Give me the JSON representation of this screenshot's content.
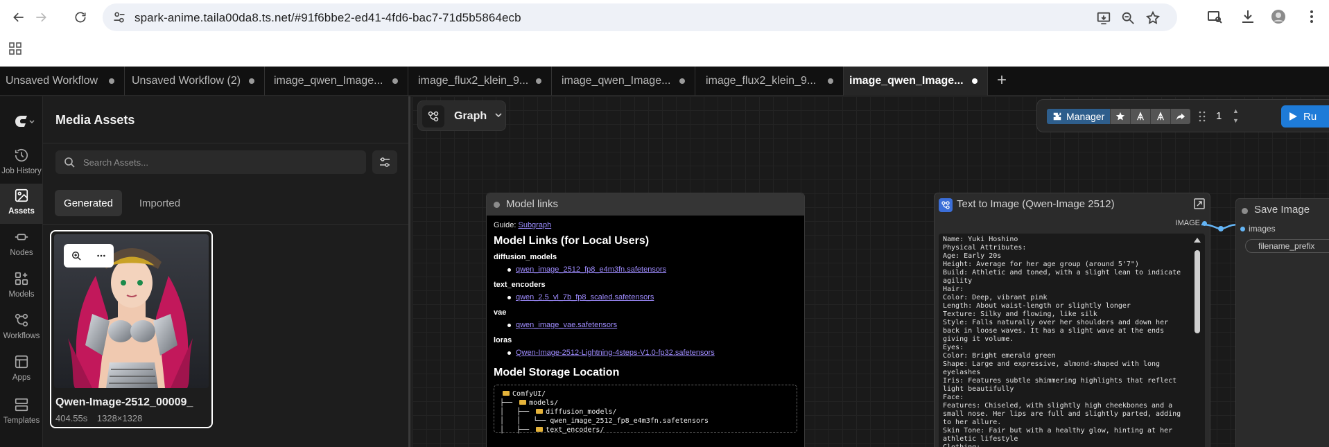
{
  "browser": {
    "url": "spark-anime.taila00da8.ts.net/#91f6bbe2-ed41-4fd6-bac7-71d5b5864ecb"
  },
  "tabs": [
    {
      "label": "Unsaved Workflow"
    },
    {
      "label": "Unsaved Workflow (2)"
    },
    {
      "label": "image_qwen_Image..."
    },
    {
      "label": "image_flux2_klein_9..."
    },
    {
      "label": "image_qwen_Image..."
    },
    {
      "label": "image_flux2_klein_9..."
    },
    {
      "label": "image_qwen_Image...",
      "active": true
    }
  ],
  "rail": {
    "items": [
      {
        "label": "Job History",
        "icon": "history-icon"
      },
      {
        "label": "Assets",
        "icon": "image-icon"
      },
      {
        "label": "Nodes",
        "icon": "nodes-icon"
      },
      {
        "label": "Models",
        "icon": "models-icon"
      },
      {
        "label": "Workflows",
        "icon": "workflow-icon"
      },
      {
        "label": "Apps",
        "icon": "apps-icon"
      },
      {
        "label": "Templates",
        "icon": "templates-icon"
      }
    ]
  },
  "assets": {
    "title": "Media Assets",
    "search_placeholder": "Search Assets...",
    "tab_generated": "Generated",
    "tab_imported": "Imported",
    "card": {
      "name": "Qwen-Image-2512_00009_",
      "duration": "404.55s",
      "dimensions": "1328×1328"
    }
  },
  "canvas": {
    "graph_label": "Graph",
    "manager_label": "Manager",
    "batch_count": "1",
    "run_label": "Ru"
  },
  "model_links": {
    "title": "Model links",
    "guide_prefix": "Guide:",
    "guide_link": "Subgraph",
    "heading": "Model Links (for Local Users)",
    "groups": [
      {
        "name": "diffusion_models",
        "file": "qwen_image_2512_fp8_e4m3fn.safetensors"
      },
      {
        "name": "text_encoders",
        "file": "qwen_2.5_vl_7b_fp8_scaled.safetensors"
      },
      {
        "name": "vae",
        "file": "qwen_image_vae.safetensors"
      },
      {
        "name": "loras",
        "file": "Qwen-Image-2512-Lightning-4steps-V1.0-fp32.safetensors"
      }
    ],
    "storage_heading": "Model Storage Location",
    "tree": {
      "root": "ComfyUI/",
      "models": "models/",
      "diffusion": "diffusion_models/",
      "diffusion_file": "qwen_image_2512_fp8_e4m3fn.safetensors",
      "text_encoders": "text_encoders/"
    }
  },
  "t2i": {
    "title": "Text to Image (Qwen-Image 2512)",
    "output_label": "IMAGE",
    "prompt": "Name: Yuki Hoshino\nPhysical Attributes:\nAge: Early 20s\nHeight: Average for her age group (around 5'7\")\nBuild: Athletic and toned, with a slight lean to indicate agility\nHair:\nColor: Deep, vibrant pink\nLength: About waist-length or slightly longer\nTexture: Silky and flowing, like silk\nStyle: Falls naturally over her shoulders and down her back in loose waves. It has a slight wave at the ends giving it volume.\nEyes:\nColor: Bright emerald green\nShape: Large and expressive, almond-shaped with long eyelashes\nIris: Features subtle shimmering highlights that reflect light beautifully\nFace:\nFeatures: Chiseled, with slightly high cheekbones and a small nose. Her lips are full and slightly parted, adding to her allure.\nSkin Tone: Fair but with a healthy glow, hinting at her athletic lifestyle\nClothing:\nTop Half:"
  },
  "save_image": {
    "title": "Save Image",
    "input_label": "images",
    "prefix_field": "filename_prefix"
  }
}
